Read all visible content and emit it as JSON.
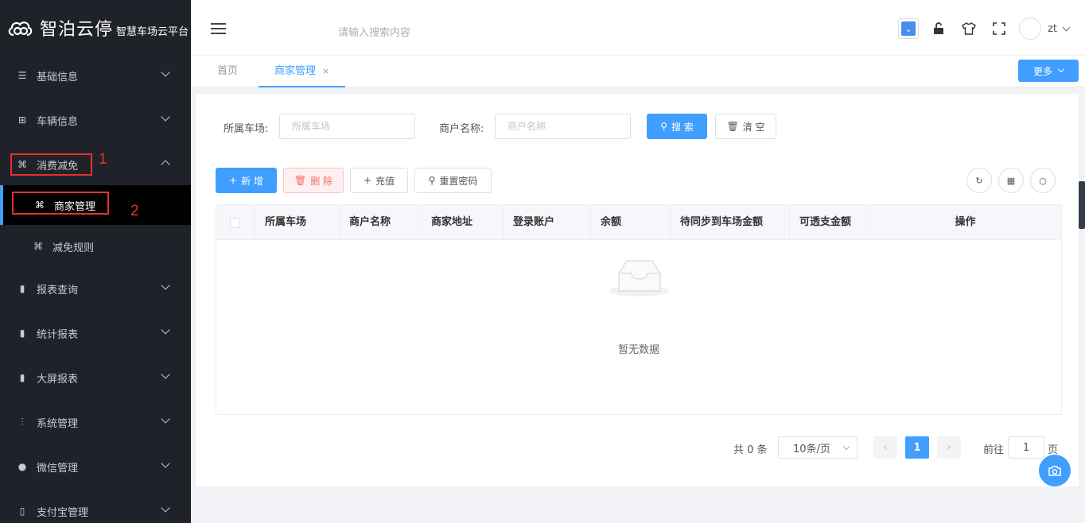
{
  "brand": {
    "name": "智泊云停",
    "subtitle": "智慧车场云平台"
  },
  "sidebar": {
    "items": [
      {
        "label": "基础信息",
        "icon": "list-icon",
        "glyph": "☰"
      },
      {
        "label": "车辆信息",
        "icon": "grid-icon",
        "glyph": "⊞"
      },
      {
        "label": "消费减免",
        "icon": "clover-icon",
        "glyph": "⌘",
        "expanded": true
      },
      {
        "label": "报表查询",
        "icon": "bar-chart-icon",
        "glyph": "▮"
      },
      {
        "label": "统计报表",
        "icon": "bar-chart-icon",
        "glyph": "▮"
      },
      {
        "label": "大屏报表",
        "icon": "bar-chart-icon",
        "glyph": "▮"
      },
      {
        "label": "系统管理",
        "icon": "sliders-icon",
        "glyph": "⫶"
      },
      {
        "label": "微信管理",
        "icon": "wechat-icon",
        "glyph": "●"
      },
      {
        "label": "支付宝管理",
        "icon": "mobile-icon",
        "glyph": "▯"
      }
    ],
    "sub_items": [
      {
        "label": "商家管理",
        "icon": "clover-icon",
        "glyph": "⌘",
        "active": true
      },
      {
        "label": "减免规则",
        "icon": "clover-icon",
        "glyph": "⌘"
      }
    ],
    "annotations": [
      "1",
      "2"
    ]
  },
  "header": {
    "search_placeholder": "请输入搜索内容",
    "username": "zt"
  },
  "tabs": [
    {
      "label": "首页"
    },
    {
      "label": "商家管理",
      "close": "×"
    }
  ],
  "more_label": "更多",
  "filters": {
    "parking_label": "所属车场:",
    "parking_placeholder": "所属车场",
    "merchant_label": "商户名称:",
    "merchant_placeholder": "商户名称",
    "search_btn": "搜 索",
    "clear_btn": "清 空"
  },
  "toolbar": {
    "add": "新 增",
    "delete": "删 除",
    "recharge": "充值",
    "reset_pwd": "重置密码"
  },
  "table": {
    "columns": [
      "所属车场",
      "商户名称",
      "商家地址",
      "登录账户",
      "余额",
      "待同步到车场金额",
      "可透支金额",
      "操作"
    ],
    "empty_text": "暂无数据"
  },
  "pagination": {
    "total": "共 0 条",
    "page_size": "10条/页",
    "current_page": "1",
    "goto_label": "前往",
    "goto_value": "1",
    "page_suffix": "页"
  },
  "colors": {
    "accent": "#409eff",
    "sidebar_bg": "#20222a",
    "annotation": "#e5322d"
  }
}
